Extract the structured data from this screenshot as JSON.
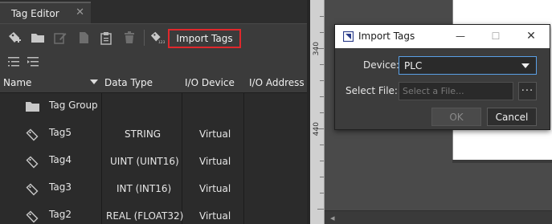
{
  "tab": {
    "title": "Tag Editor",
    "close_glyph": "✕"
  },
  "toolbar": {
    "icons": [
      "add-tag-icon",
      "folder-icon",
      "edit-icon",
      "copy-icon",
      "paste-icon",
      "delete-icon",
      "import-tags-icon"
    ],
    "import_label": "Import Tags",
    "highlight_color": "#e0282c"
  },
  "subtoolbar": {
    "icons": [
      "collapse-all-icon",
      "expand-all-icon"
    ]
  },
  "table": {
    "headers": [
      "Name",
      "Data Type",
      "I/O Device",
      "I/O Address"
    ],
    "rows": [
      {
        "name": "Tag Group",
        "type": "",
        "device": "",
        "kind": "group"
      },
      {
        "name": "Tag5",
        "type": "STRING",
        "device": "Virtual",
        "kind": "tag"
      },
      {
        "name": "Tag4",
        "type": "UINT (UINT16)",
        "device": "Virtual",
        "kind": "tag"
      },
      {
        "name": "Tag3",
        "type": "INT (INT16)",
        "device": "Virtual",
        "kind": "tag"
      },
      {
        "name": "Tag2",
        "type": "REAL (FLOAT32)",
        "device": "Virtual",
        "kind": "tag"
      }
    ]
  },
  "ruler": {
    "labels": [
      "340",
      "440"
    ]
  },
  "dialog": {
    "title": "Import Tags",
    "device_label": "Device:",
    "device_value": "PLC",
    "file_label": "Select File:",
    "file_placeholder": "Select a File...",
    "browse_label": "···",
    "ok_label": "OK",
    "cancel_label": "Cancel",
    "minimize_glyph": "—",
    "maximize_glyph": "☐",
    "close_glyph": "✕"
  }
}
